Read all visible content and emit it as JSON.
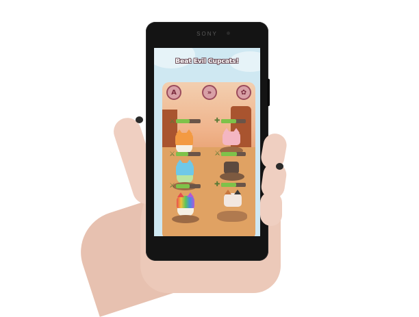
{
  "device": {
    "brand": "SONY"
  },
  "game": {
    "title": "Beat Evil Cupcats!",
    "top_buttons": [
      {
        "name": "achievements-icon",
        "glyph": "A"
      },
      {
        "name": "fast-forward-icon",
        "glyph": "»"
      },
      {
        "name": "settings-gear-icon",
        "glyph": "✿"
      }
    ],
    "colors": {
      "health_bar": "#7ec24a",
      "title_outline": "#6a4a55",
      "button_ring": "#9b4b5c"
    },
    "cupcats": [
      {
        "name": "orange-cupcat",
        "side": "left",
        "row": 1,
        "health": 0.55
      },
      {
        "name": "pink-cupcat",
        "side": "right",
        "row": 1,
        "health": 0.6
      },
      {
        "name": "blue-cupcat",
        "side": "left",
        "row": 2,
        "health": 0.5
      },
      {
        "name": "dark-cupcat-crate",
        "side": "right",
        "row": 2,
        "health": 0.65
      },
      {
        "name": "rainbow-cupcat",
        "side": "left",
        "row": 3,
        "health": 0.55
      },
      {
        "name": "calico-cupcat",
        "side": "right",
        "row": 3,
        "health": 0.6
      }
    ]
  }
}
